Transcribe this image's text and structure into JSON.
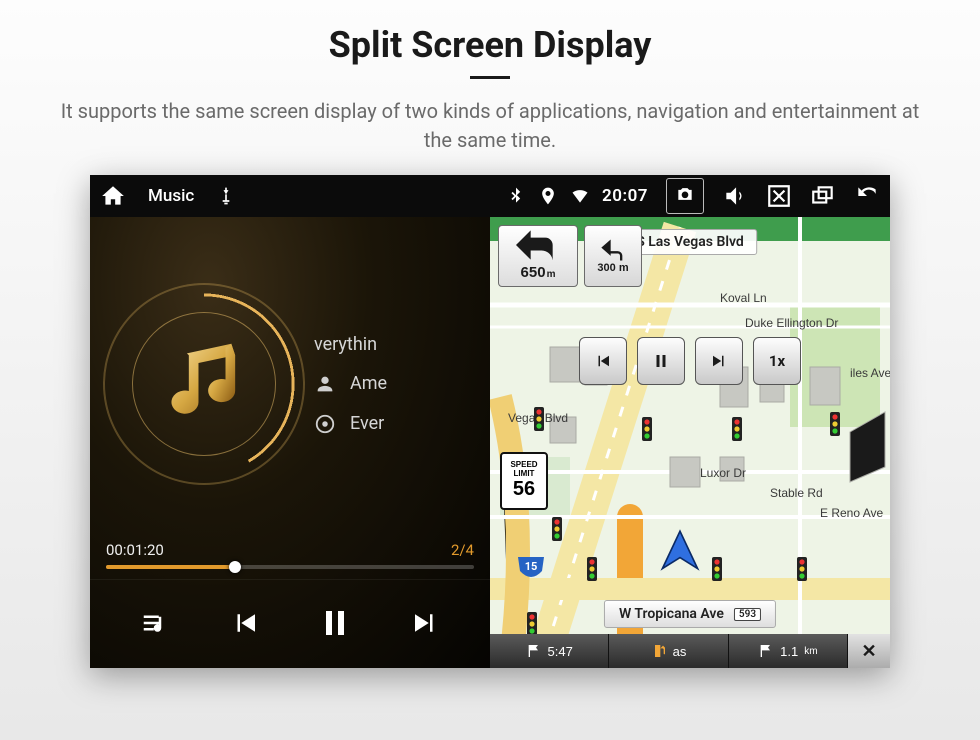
{
  "hero": {
    "title": "Split Screen Display",
    "desc": "It supports the same screen display of two kinds of applications, navigation and entertainment at the same time."
  },
  "statusbar": {
    "app_label": "Music",
    "time": "20:07"
  },
  "music": {
    "tracks": {
      "t1": "verythin",
      "t2": "Ame",
      "t3": "Ever"
    },
    "elapsed": "00:01:20",
    "index": "2/4"
  },
  "nav": {
    "next_turn_dist": "300",
    "next_turn_unit": "m",
    "main_turn_dist": "650",
    "main_turn_unit": "m",
    "top_street": "S Las Vegas Blvd",
    "bottom_street": "W Tropicana Ave",
    "bottom_badge": "593",
    "speed_limit_top1": "SPEED",
    "speed_limit_top2": "LIMIT",
    "speed_limit_value": "56",
    "roads": {
      "koval": "Koval Ln",
      "duke": "Duke Ellington Dr",
      "vegas": "Vegas Blvd",
      "luxor": "Luxor Dr",
      "stable": "Stable Rd",
      "ereno": "E Reno Ave",
      "iles": "iles Ave"
    },
    "hwy_label": "15",
    "media_speed": "1x",
    "hud": {
      "eta": "5:47",
      "fuel": "as",
      "dist": "1.1",
      "dist_unit": "km"
    }
  }
}
